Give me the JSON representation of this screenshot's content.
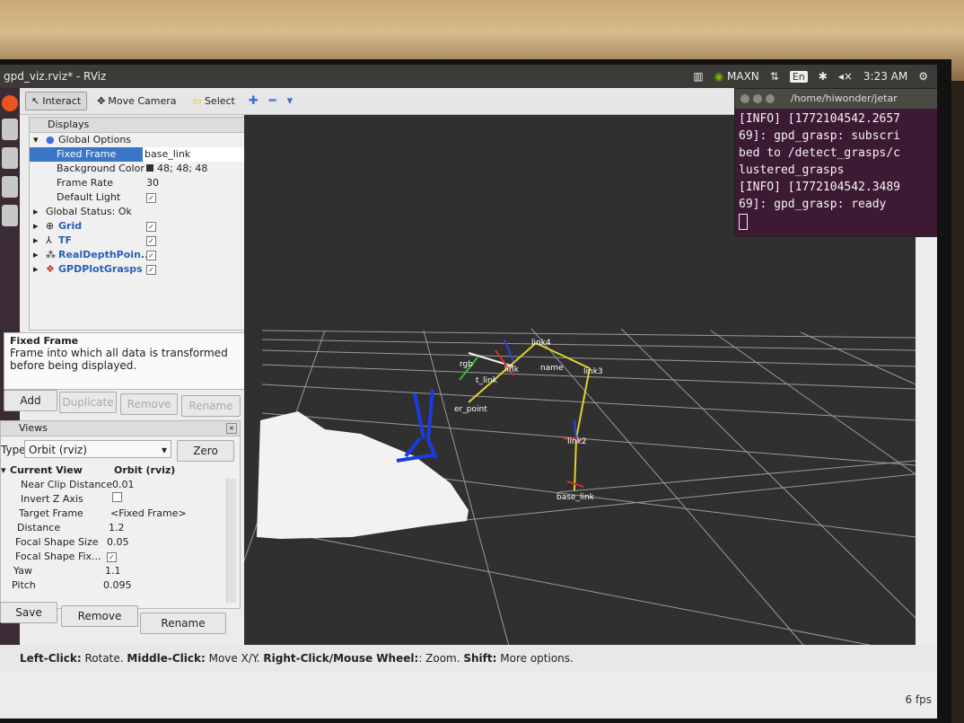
{
  "window": {
    "title": "gpd_viz.rviz* - RViz"
  },
  "tray": {
    "nvidia": "MAXN",
    "lang": "En",
    "clock": "3:23 AM"
  },
  "toolbar": {
    "interact": "Interact",
    "move_camera": "Move Camera",
    "select": "Select"
  },
  "displays": {
    "header": "Displays",
    "global_options": "Global Options",
    "rows": [
      {
        "key": "Fixed Frame",
        "value": "base_link"
      },
      {
        "key": "Background Color",
        "value": "48; 48; 48",
        "color": "#303030"
      },
      {
        "key": "Frame Rate",
        "value": "30"
      },
      {
        "key": "Default Light",
        "value": "✓"
      }
    ],
    "global_status": "Global Status: Ok",
    "items": [
      "Grid",
      "TF",
      "RealDepthPoin...",
      "GPDPlotGrasps"
    ]
  },
  "description": {
    "title": "Fixed Frame",
    "text": "Frame into which all data is transformed before being displayed."
  },
  "display_buttons": {
    "add": "Add",
    "duplicate": "Duplicate",
    "remove": "Remove",
    "rename": "Rename"
  },
  "views": {
    "header": "Views",
    "type_label": "Type:",
    "type_value": "Orbit (rviz)",
    "zero": "Zero",
    "current_view": "Current View",
    "current_view_value": "Orbit (rviz)",
    "rows": [
      {
        "key": "Near Clip Distance",
        "value": "0.01"
      },
      {
        "key": "Invert Z Axis",
        "value": ""
      },
      {
        "key": "Target Frame",
        "value": "<Fixed Frame>"
      },
      {
        "key": "Distance",
        "value": "1.2"
      },
      {
        "key": "Focal Shape Size",
        "value": "0.05"
      },
      {
        "key": "Focal Shape Fix...",
        "value": "✓"
      },
      {
        "key": "Yaw",
        "value": "1.1"
      },
      {
        "key": "Pitch",
        "value": "0.095"
      }
    ],
    "save": "Save",
    "remove": "Remove",
    "rename": "Rename"
  },
  "viewport_labels": {
    "link4": "link4",
    "link3": "link3",
    "link2": "link2",
    "base_link": "base_link",
    "er_point": "er_point",
    "rgb": "rgb",
    "link": "link",
    "name": "name",
    "t_link": "t_link"
  },
  "statusbar": {
    "left_click": "Left-Click:",
    "rotate": " Rotate. ",
    "middle_click": "Middle-Click:",
    "move": " Move X/Y. ",
    "right_click": "Right-Click/Mouse Wheel:",
    "zoom": ": Zoom. ",
    "shift": "Shift:",
    "more": " More options."
  },
  "fps": "6 fps",
  "terminal": {
    "path": "/home/hiwonder/jetar",
    "lines": [
      "[INFO] [1772104542.2657",
      "69]: gpd_grasp: subscri",
      "bed to /detect_grasps/c",
      "lustered_grasps",
      "[INFO] [1772104542.3489",
      "69]: gpd_grasp: ready"
    ]
  }
}
